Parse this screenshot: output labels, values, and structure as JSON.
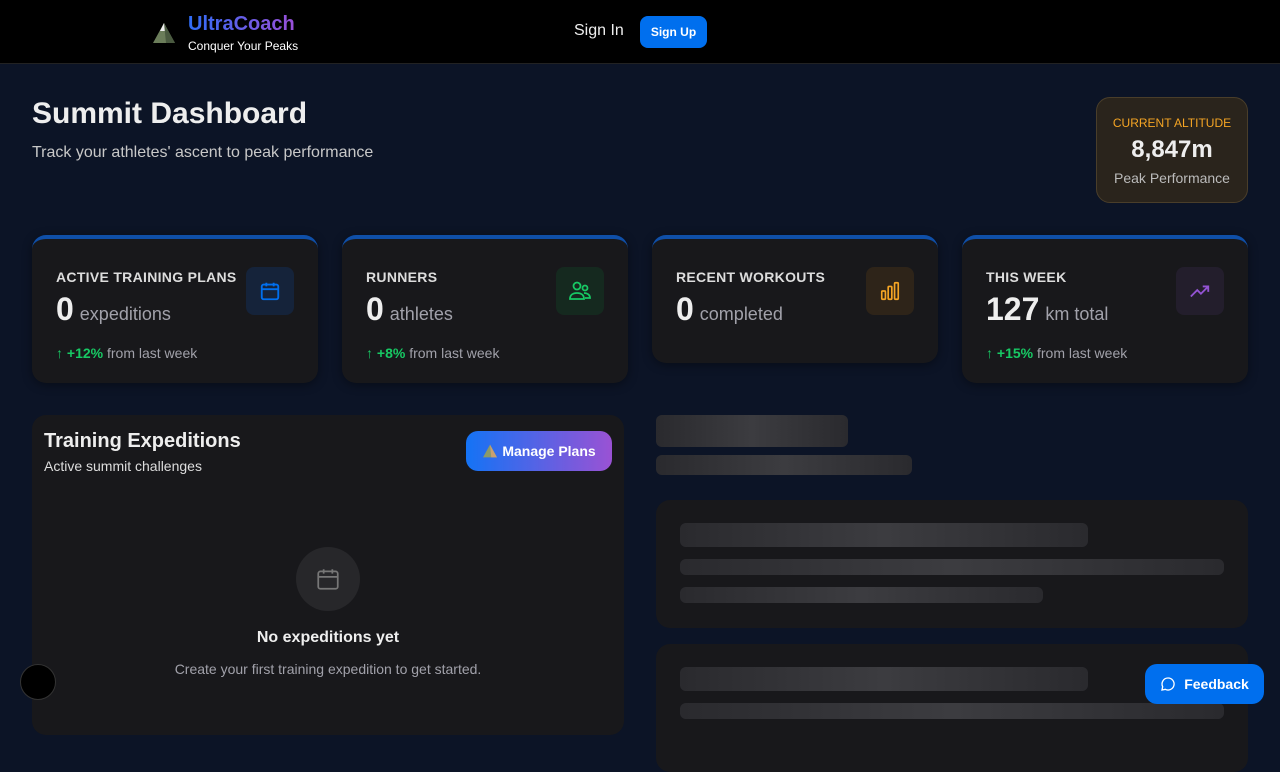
{
  "header": {
    "brand": "UltraCoach",
    "tagline": "Conquer Your Peaks",
    "sign_in": "Sign In",
    "sign_up": "Sign Up"
  },
  "page": {
    "title": "Summit Dashboard",
    "subtitle": "Track your athletes' ascent to peak performance"
  },
  "altitude": {
    "label": "CURRENT ALTITUDE",
    "value": "8,847m",
    "caption": "Peak Performance",
    "color": "#f5a524"
  },
  "stats": [
    {
      "title": "ACTIVE TRAINING PLANS",
      "value": "0",
      "unit": "expeditions",
      "icon": "calendar-icon",
      "color": "#006fee",
      "trend": "+12%",
      "trend_text": "from last week"
    },
    {
      "title": "RUNNERS",
      "value": "0",
      "unit": "athletes",
      "icon": "users-icon",
      "color": "#17c964",
      "trend": "+8%",
      "trend_text": "from last week"
    },
    {
      "title": "RECENT WORKOUTS",
      "value": "0",
      "unit": "completed",
      "icon": "bar-chart-icon",
      "color": "#f5a524"
    },
    {
      "title": "THIS WEEK",
      "value": "127",
      "unit": "km total",
      "icon": "trending-up-icon",
      "color": "#9353d3",
      "trend": "+15%",
      "trend_text": "from last week"
    }
  ],
  "expeditions": {
    "title": "Training Expeditions",
    "subtitle": "Active summit challenges",
    "manage": "Manage Plans",
    "empty_title": "No expeditions yet",
    "empty_desc": "Create your first training expedition to get started."
  },
  "feedback": "Feedback"
}
